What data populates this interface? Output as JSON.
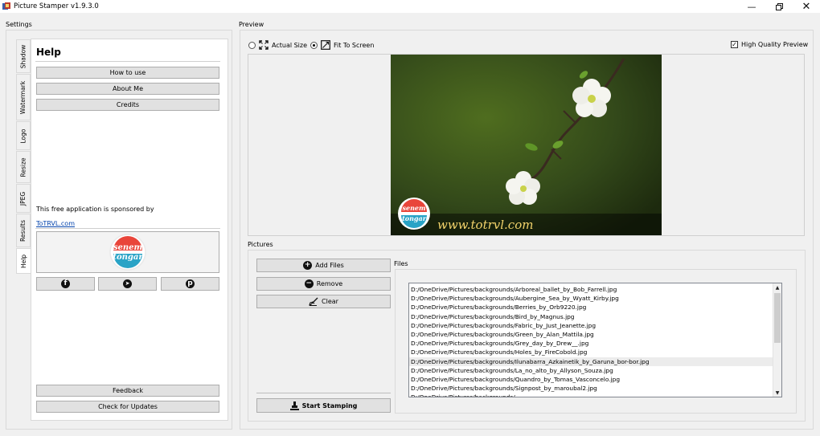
{
  "window": {
    "title": "Picture Stamper v1.9.3.0"
  },
  "settings": {
    "label": "Settings"
  },
  "tabs": [
    {
      "label": "Shadow",
      "icon": "shadow-tab"
    },
    {
      "label": "Watermark",
      "icon": "watermark-tab"
    },
    {
      "label": "Logo",
      "icon": "logo-tab"
    },
    {
      "label": "Resize",
      "icon": "resize-tab"
    },
    {
      "label": "JPEG",
      "icon": "jpeg-tab"
    },
    {
      "label": "Results",
      "icon": "results-tab"
    },
    {
      "label": "Help",
      "icon": "help-tab"
    }
  ],
  "help": {
    "heading": "Help",
    "buttons": {
      "how_to_use": "How to use",
      "about_me": "About Me",
      "credits": "Credits"
    },
    "sponsor_text": "This free application is sponsored by",
    "sponsor_link": "ToTRVL.com",
    "logo_text": {
      "line1": "senem",
      "line2": "tongar"
    },
    "social": [
      "facebook-icon",
      "twitter-icon",
      "pinterest-icon"
    ],
    "feedback": "Feedback",
    "check_updates": "Check for Updates"
  },
  "preview": {
    "label": "Preview",
    "actual_size": "Actual Size",
    "fit_to_screen": "Fit To Screen",
    "selected": "fit_to_screen",
    "high_quality": "High Quality Preview",
    "high_quality_checked": true,
    "watermark_text": "www.totrvl.com",
    "logo_text": {
      "line1": "senem",
      "line2": "tongar"
    }
  },
  "pictures": {
    "label": "Pictures",
    "add_files": "Add Files",
    "remove": "Remove",
    "clear": "Clear",
    "start_stamping": "Start Stamping",
    "files_label": "Files",
    "files": [
      "D:/OneDrive/Pictures/backgrounds/Arboreal_ballet_by_Bob_Farrell.jpg",
      "D:/OneDrive/Pictures/backgrounds/Aubergine_Sea_by_Wyatt_Kirby.jpg",
      "D:/OneDrive/Pictures/backgrounds/Berries_by_Orb9220.jpg",
      "D:/OneDrive/Pictures/backgrounds/Bird_by_Magnus.jpg",
      "D:/OneDrive/Pictures/backgrounds/Fabric_by_Just_Jeanette.jpg",
      "D:/OneDrive/Pictures/backgrounds/Green_by_Alan_Mattila.jpg",
      "D:/OneDrive/Pictures/backgrounds/Grey_day_by_Drew__.jpg",
      "D:/OneDrive/Pictures/backgrounds/Holes_by_FireCobold.jpg",
      "D:/OneDrive/Pictures/backgrounds/Ilunabarra_Azkainetik_by_Garuna_bor-bor.jpg",
      "D:/OneDrive/Pictures/backgrounds/La_no_alto_by_Allyson_Souza.jpg",
      "D:/OneDrive/Pictures/backgrounds/Quandro_by_Tomas_Vasconcelo.jpg",
      "D:/OneDrive/Pictures/backgrounds/Signpost_by_maroubal2.jpg",
      "D:/OneDrive/Pictures/backgrounds/..."
    ],
    "selected_index": 8
  }
}
